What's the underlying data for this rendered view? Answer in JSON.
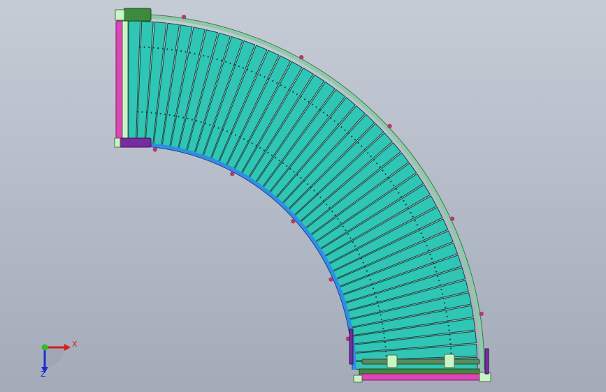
{
  "viewport": {
    "background_top": "#c6ccd6",
    "background_bottom": "#a3abb9"
  },
  "model": {
    "description_icon": "curved-roller-conveyor",
    "roller_count": 42,
    "colors": {
      "roller_fill": "#2ec6b4",
      "roller_edge": "#0c4a44",
      "outer_guard": "#8fcaa8",
      "outer_guard_edge": "#3e7458",
      "inner_guard": "#2f8fe6",
      "inner_guard_edge": "#0a3f8a",
      "end_roller": "#e044b8",
      "end_plate": "#7a2aa0",
      "bracket_green": "#3d8a3d",
      "bracket_light": "#c9f4c4",
      "bolt": "#b03a72",
      "chain_dot": "#10302c",
      "shaft": "#5a8a5a"
    }
  },
  "triad": {
    "x_label": "X",
    "z_label": "Z",
    "x_color": "#d61e1e",
    "y_color": "#2bbf2b",
    "z_color": "#1c2ed0"
  }
}
